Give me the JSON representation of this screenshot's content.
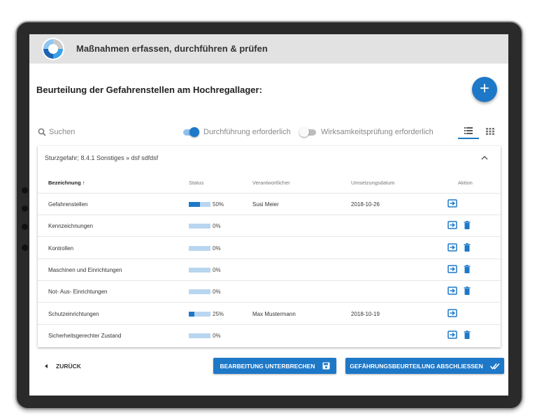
{
  "app": {
    "title": "Maßnahmen erfassen, durchführen & prüfen"
  },
  "page": {
    "heading": "Beurteilung der Gefahrenstellen am Hochregallager:"
  },
  "fab": {
    "label": "+",
    "icon": "add-icon"
  },
  "filters": {
    "search_placeholder": "Suchen",
    "toggle1": {
      "label": "Durchführung erforderlich",
      "on": true
    },
    "toggle2": {
      "label": "Wirksamkeitsprüfung erforderlich",
      "on": false
    },
    "view": {
      "active": "list",
      "options": [
        "list-view-icon",
        "grid-view-icon"
      ]
    }
  },
  "card": {
    "header": "Sturzgefahr; 8.4.1 Sonstiges » dsf sdfdsf",
    "columns": {
      "name": "Bezeichnung",
      "sort_arrow": "↑",
      "status": "Status",
      "responsible": "Verantwortlicher",
      "date": "Umsetzungsdatum",
      "action": "Aktion"
    },
    "rows": [
      {
        "name": "Gefahrenstellen",
        "status": "50%",
        "progress": 0.5,
        "responsible": "Susi Meier",
        "date": "2018-10-26",
        "deletable": false
      },
      {
        "name": "Kennzeichnungen",
        "status": "0%",
        "progress": 0,
        "responsible": "",
        "date": "",
        "deletable": true
      },
      {
        "name": "Kontrollen",
        "status": "0%",
        "progress": 0,
        "responsible": "",
        "date": "",
        "deletable": true
      },
      {
        "name": "Maschinen und Einrichtungen",
        "status": "0%",
        "progress": 0,
        "responsible": "",
        "date": "",
        "deletable": true
      },
      {
        "name": "Not- Aus- Einrichtungen",
        "status": "0%",
        "progress": 0,
        "responsible": "",
        "date": "",
        "deletable": true
      },
      {
        "name": "Schutzeinrichtungen",
        "status": "25%",
        "progress": 0.25,
        "responsible": "Max Mustermann",
        "date": "2018-10-19",
        "deletable": false
      },
      {
        "name": "Sicherheitsgerechter Zustand",
        "status": "0%",
        "progress": 0,
        "responsible": "",
        "date": "",
        "deletable": true
      }
    ]
  },
  "footer": {
    "back_label": "ZURÜCK",
    "pause_label": "BEARBEITUNG UNTERBRECHEN",
    "finish_label": "GEFÄHRUNGSBEURTEILUNG ABSCHLIESSEN"
  },
  "colors": {
    "primary": "#1e78c8",
    "progress_track": "#b9d6f1",
    "appbar": "#e2e2e2"
  }
}
